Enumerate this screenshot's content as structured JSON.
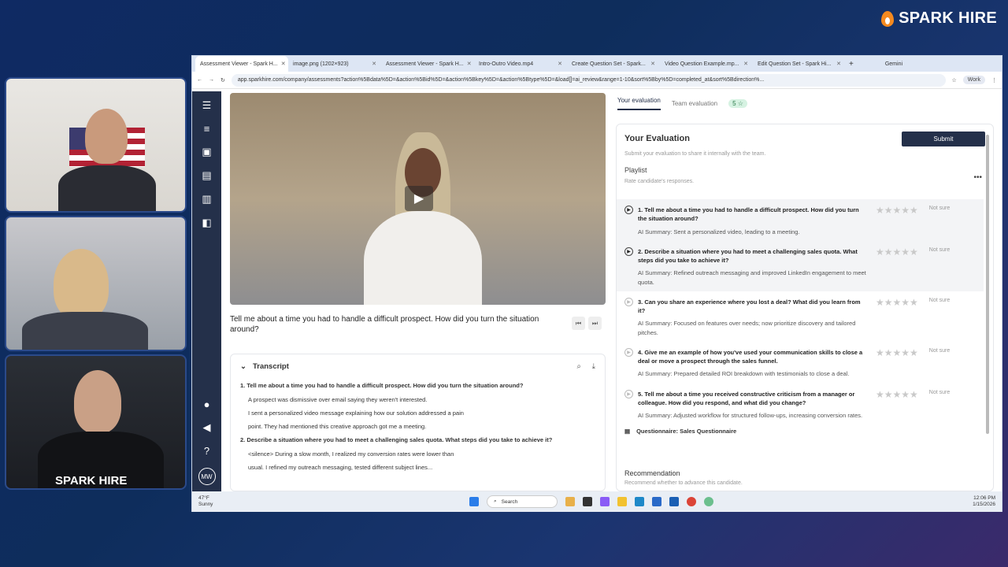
{
  "brand": {
    "name": "SPARK HIRE"
  },
  "participants": {
    "shirt_logo": "SPARK HIRE"
  },
  "browser": {
    "tabs": [
      {
        "label": "Assessment Viewer - Spark H..."
      },
      {
        "label": "image.png (1202×923)"
      },
      {
        "label": "Assessment Viewer - Spark H..."
      },
      {
        "label": "Intro-Outro Video.mp4"
      },
      {
        "label": "Create Question Set - Spark..."
      },
      {
        "label": "Video Question Example.mp..."
      },
      {
        "label": "Edit Question Set - Spark Hi..."
      }
    ],
    "gemini_label": "Gemini",
    "url": "app.sparkhire.com/company/assessments?action%5Bdata%5D=&action%5Bid%5D=&action%5Bkey%5D=&action%5Btype%5D=&load[]=ai_review&range=1-10&sort%5Bby%5D=completed_at&sort%5Bdirection%...",
    "profile_label": "Work"
  },
  "sidebar": {
    "avatar_initials": "MW"
  },
  "video": {
    "question": "Tell me about a time you had to handle a difficult prospect. How did you turn the situation around?"
  },
  "transcript": {
    "title": "Transcript",
    "blocks": [
      {
        "q": "1. Tell me about a time you had to handle a difficult prospect. How did you turn the situation around?"
      },
      {
        "a": "A prospect was dismissive over email saying they weren't interested."
      },
      {
        "a": "I sent a personalized video message explaining how our solution addressed a pain"
      },
      {
        "a": "point. They had mentioned this creative approach got me a meeting."
      },
      {
        "q": "2. Describe a situation where you had to meet a challenging sales quota. What steps did you take to achieve it?"
      },
      {
        "a": "<silence> During a slow month, I realized my conversion rates were lower than"
      },
      {
        "a": "usual. I refined my outreach messaging, tested different subject lines..."
      }
    ]
  },
  "evaluation": {
    "tab_yours": "Your evaluation",
    "tab_team": "Team evaluation",
    "team_count": "5 ☆",
    "title": "Your Evaluation",
    "submit_label": "Submit",
    "subtitle": "Submit your evaluation to share it internally with the team.",
    "playlist_label": "Playlist",
    "playlist_sub": "Rate candidate's responses.",
    "not_sure": "Not sure",
    "items": [
      {
        "q": "1. Tell me about a time you had to handle a difficult prospect. How did you turn the situation around?",
        "ai": "AI Summary: Sent a personalized video, leading to a meeting."
      },
      {
        "q": "2. Describe a situation where you had to meet a challenging sales quota. What steps did you take to achieve it?",
        "ai": "AI Summary: Refined outreach messaging and improved LinkedIn engagement to meet quota."
      },
      {
        "q": "3. Can you share an experience where you lost a deal? What did you learn from it?",
        "ai": "AI Summary: Focused on features over needs; now prioritize discovery and tailored pitches."
      },
      {
        "q": "4. Give me an example of how you've used your communication skills to close a deal or move a prospect through the sales funnel.",
        "ai": "AI Summary: Prepared detailed ROI breakdown with testimonials to close a deal."
      },
      {
        "q": "5. Tell me about a time you received constructive criticism from a manager or colleague. How did you respond, and what did you change?",
        "ai": "AI Summary: Adjusted workflow for structured follow-ups, increasing conversion rates."
      }
    ],
    "questionnaire": "Questionnaire: Sales Questionnaire",
    "recommendation_title": "Recommendation",
    "recommendation_sub": "Recommend whether to advance this candidate."
  },
  "taskbar": {
    "temp": "47°F",
    "weather": "Sunny",
    "search_placeholder": "Search",
    "time": "12:06 PM",
    "date": "1/15/2026"
  }
}
